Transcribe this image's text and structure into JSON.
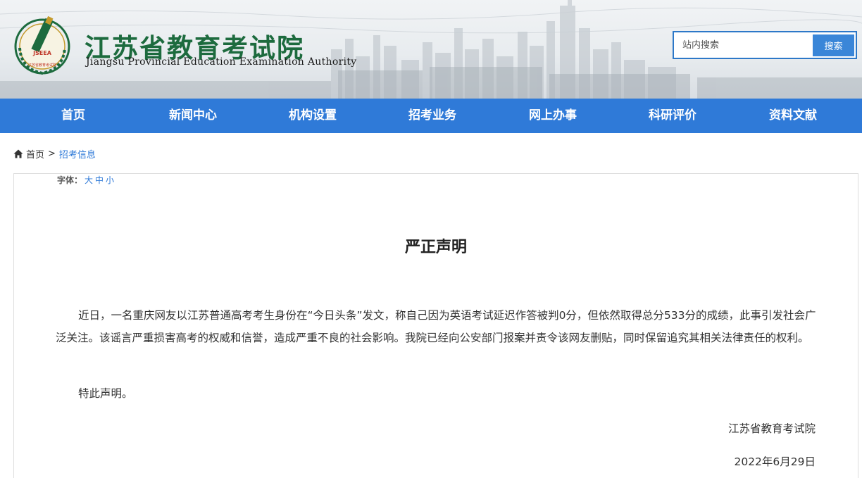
{
  "header": {
    "logo_cn": "江苏省教育考试院",
    "logo_en": "Jiangsu Provincial Education Examination Authority",
    "emblem_ring_text": "江苏省教育考试院",
    "emblem_letters": "JSEEA",
    "brand_green": "#1d6b3e"
  },
  "search": {
    "placeholder": "站内搜索",
    "button_label": "搜索"
  },
  "nav": {
    "background": "#2f7ad8",
    "items": [
      {
        "label": "首页"
      },
      {
        "label": "新闻中心"
      },
      {
        "label": "机构设置"
      },
      {
        "label": "招考业务"
      },
      {
        "label": "网上办事"
      },
      {
        "label": "科研评价"
      },
      {
        "label": "资料文献"
      }
    ]
  },
  "breadcrumb": {
    "home_icon": "home-icon",
    "home": "首页",
    "separator": ">",
    "current": "招考信息"
  },
  "font_size": {
    "label": "字体：",
    "large": "大",
    "medium": "中",
    "small": "小"
  },
  "article": {
    "title": "严正声明",
    "paragraph1": "近日，一名重庆网友以江苏普通高考考生身份在“今日头条”发文，称自己因为英语考试延迟作答被判0分，但依然取得总分533分的成绩，此事引发社会广泛关注。该谣言严重损害高考的权威和信誉，造成严重不良的社会影响。我院已经向公安部门报案并责令该网友删贴，同时保留追究其相关法律责任的权利。",
    "paragraph2": "特此声明。",
    "signature": "江苏省教育考试院",
    "date": "2022年6月29日"
  }
}
